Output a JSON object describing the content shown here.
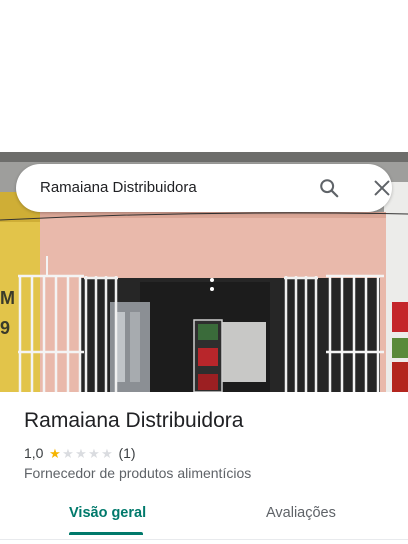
{
  "search": {
    "query": "Ramaiana Distribuidora",
    "search_icon": "search-icon",
    "close_icon": "close-icon"
  },
  "place": {
    "name": "Ramaiana Distribuidora",
    "rating": "1,0",
    "stars_filled": 1,
    "stars_total": 5,
    "review_count": "(1)",
    "category": "Fornecedor de produtos alimentícios"
  },
  "tabs": [
    {
      "label": "Visão geral",
      "selected": true
    },
    {
      "label": "Avaliações",
      "selected": false
    }
  ],
  "colors": {
    "accent": "#00796b",
    "star": "#f5b400",
    "wall": "#e9b9ab"
  }
}
